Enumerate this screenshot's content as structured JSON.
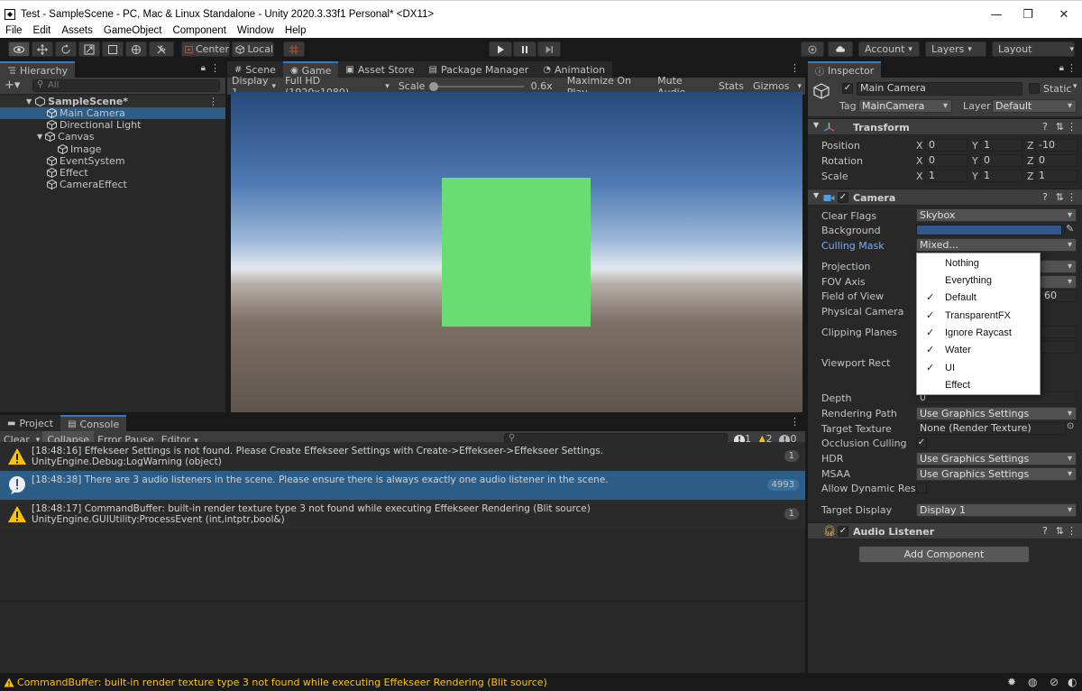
{
  "window": {
    "title": "Test - SampleScene - PC, Mac & Linux Standalone - Unity 2020.3.33f1 Personal* <DX11>",
    "minimize": "—",
    "maximize": "❐",
    "close": "✕"
  },
  "menubar": [
    "File",
    "Edit",
    "Assets",
    "GameObject",
    "Component",
    "Window",
    "Help"
  ],
  "toolbar": {
    "pivot_center": "Center",
    "pivot_local": "Local",
    "account": "Account",
    "layers": "Layers",
    "layout": "Layout"
  },
  "hierarchy": {
    "tab": "Hierarchy",
    "search_placeholder": "All",
    "scene": "SampleScene*",
    "items": [
      "Main Camera",
      "Directional Light",
      "Canvas",
      "Image",
      "EventSystem",
      "Effect",
      "CameraEffect"
    ]
  },
  "gameview": {
    "tabs": [
      "Scene",
      "Game",
      "Asset Store",
      "Package Manager",
      "Animation"
    ],
    "display": "Display 1",
    "resolution": "Full HD (1920x1080)",
    "scale_label": "Scale",
    "scale_value": "0.6x",
    "scale_fraction": 0.0,
    "maximize_on_play": "Maximize On Play",
    "mute_audio": "Mute Audio",
    "stats": "Stats",
    "gizmos": "Gizmos",
    "quad_color": "#69dd72"
  },
  "console": {
    "tabs": [
      "Project",
      "Console"
    ],
    "clear": "Clear",
    "collapse": "Collapse",
    "error_pause": "Error Pause",
    "editor": "Editor",
    "badge_info": "1",
    "badge_warn": "2",
    "badge_error": "0",
    "messages": [
      {
        "line1": "[18:48:16] Effekseer Settings is not found. Please Create Effekseer Settings with Create->Effekseer->Effekseer Settings.",
        "line2": "UnityEngine.Debug:LogWarning (object)",
        "count": "1",
        "level": "warning"
      },
      {
        "line1": "[18:48:38] There are 3 audio listeners in the scene. Please ensure there is always exactly one audio listener in the scene.",
        "line2": "",
        "count": "4993",
        "level": "info"
      },
      {
        "line1": "[18:48:17] CommandBuffer: built-in render texture type 3 not found while executing Effekseer Rendering (Blit source)",
        "line2": "UnityEngine.GUIUtility:ProcessEvent (int,intptr,bool&)",
        "count": "1",
        "level": "warning"
      }
    ]
  },
  "inspector": {
    "tab": "Inspector",
    "object_name": "Main Camera",
    "static_label": "Static",
    "tag_label": "Tag",
    "tag_value": "MainCamera",
    "layer_label": "Layer",
    "layer_value": "Default",
    "transform": {
      "title": "Transform",
      "position_label": "Position",
      "rotation_label": "Rotation",
      "scale_label": "Scale",
      "axis_x": "X",
      "axis_y": "Y",
      "axis_z": "Z",
      "position": [
        "0",
        "1",
        "-10"
      ],
      "rotation": [
        "0",
        "0",
        "0"
      ],
      "scale": [
        "1",
        "1",
        "1"
      ]
    },
    "camera": {
      "title": "Camera",
      "clear_flags_label": "Clear Flags",
      "clear_flags_value": "Skybox",
      "background_label": "Background",
      "background_color": "#31578e",
      "culling_mask_label": "Culling Mask",
      "culling_mask_value": "Mixed...",
      "projection_label": "Projection",
      "fov_axis_label": "FOV Axis",
      "field_of_view_label": "Field of View",
      "field_of_view_value": "60",
      "physical_camera_label": "Physical Camera",
      "clipping_planes_label": "Clipping Planes",
      "viewport_rect_label": "Viewport Rect",
      "depth_label": "Depth",
      "depth_value": "0",
      "rendering_path_label": "Rendering Path",
      "rendering_path_value": "Use Graphics Settings",
      "target_texture_label": "Target Texture",
      "target_texture_value": "None (Render Texture)",
      "occlusion_culling_label": "Occlusion Culling",
      "hdr_label": "HDR",
      "hdr_value": "Use Graphics Settings",
      "msaa_label": "MSAA",
      "msaa_value": "Use Graphics Settings",
      "allow_dynamic_label": "Allow Dynamic Resol",
      "target_display_label": "Target Display",
      "target_display_value": "Display 1"
    },
    "audio_listener": {
      "title": "Audio Listener"
    },
    "add_component": "Add Component"
  },
  "culling_menu": {
    "items": [
      {
        "label": "Nothing",
        "checked": false
      },
      {
        "label": "Everything",
        "checked": false
      },
      {
        "label": "Default",
        "checked": true
      },
      {
        "label": "TransparentFX",
        "checked": true
      },
      {
        "label": "Ignore Raycast",
        "checked": true
      },
      {
        "label": "Water",
        "checked": true
      },
      {
        "label": "UI",
        "checked": true
      },
      {
        "label": "Effect",
        "checked": false
      }
    ]
  },
  "statusbar": {
    "message": "CommandBuffer: built-in render texture type 3 not found while executing Effekseer Rendering (Blit source)"
  }
}
